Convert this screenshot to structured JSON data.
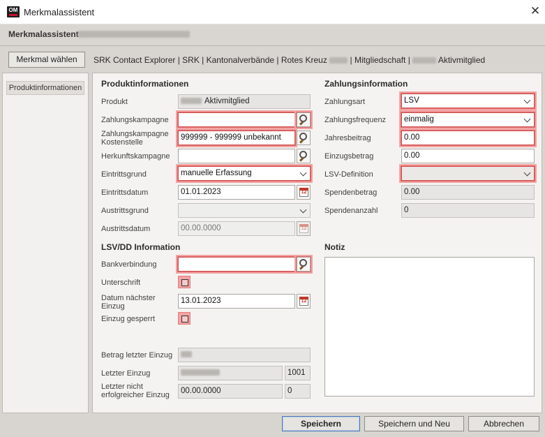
{
  "window": {
    "title": "Merkmalassistent",
    "logo": "OM",
    "close_icon": "close-icon"
  },
  "header": {
    "title": "Merkmalassistent"
  },
  "toolbar": {
    "merkmal_button": "Merkmal wählen",
    "breadcrumb_1": "SRK Contact Explorer | SRK | Kantonalverbände | Rotes Kreuz",
    "breadcrumb_2": "| Mitgliedschaft |",
    "breadcrumb_3": "Aktivmitglied"
  },
  "nav": {
    "items": [
      {
        "label": "Produktinformationen"
      }
    ]
  },
  "produkt": {
    "section_title": "Produktinformationen",
    "produkt_label": "Produkt",
    "produkt_value": "Aktivmitglied",
    "zahlungskampagne_label": "Zahlungskampagne",
    "zahlungskampagne_value": "",
    "kostenstelle_label_1": "Zahlungskampagne",
    "kostenstelle_label_2": "Kostenstelle",
    "kostenstelle_value": "999999 - 999999 unbekannt",
    "herkunft_label": "Herkunftskampagne",
    "herkunft_value": "",
    "eintrittsgrund_label": "Eintrittsgrund",
    "eintrittsgrund_value": "manuelle Erfassung",
    "eintrittsdatum_label": "Eintrittsdatum",
    "eintrittsdatum_value": "01.01.2023",
    "austrittsgrund_label": "Austrittsgrund",
    "austrittsgrund_value": "",
    "austrittsdatum_label": "Austrittsdatum",
    "austrittsdatum_value": "00.00.0000"
  },
  "lsv": {
    "section_title": "LSV/DD Information",
    "bank_label": "Bankverbindung",
    "bank_value": "",
    "unterschrift_label": "Unterschrift",
    "datum_label_1": "Datum nächster",
    "datum_label_2": "Einzug",
    "datum_value": "13.01.2023",
    "gesperrt_label": "Einzug gesperrt",
    "betrag_label": "Betrag letzter Einzug",
    "letzter_label": "Letzter Einzug",
    "letzter_count": "1001",
    "nicht_label_1": "Letzter nicht",
    "nicht_label_2": "erfolgreicher Einzug",
    "nicht_value": "00.00.0000",
    "nicht_count": "0"
  },
  "zahlung": {
    "section_title": "Zahlungsinformation",
    "art_label": "Zahlungsart",
    "art_value": "LSV",
    "frequenz_label": "Zahlungsfrequenz",
    "frequenz_value": "einmalig",
    "jahresbeitrag_label": "Jahresbeitrag",
    "jahresbeitrag_value": "0.00",
    "einzugsbetrag_label": "Einzugsbetrag",
    "einzugsbetrag_value": "0.00",
    "lsvdef_label": "LSV-Definition",
    "lsvdef_value": "",
    "spendenbetrag_label": "Spendenbetrag",
    "spendenbetrag_value": "0.00",
    "spendenanzahl_label": "Spendenanzahl",
    "spendenanzahl_value": "0"
  },
  "notiz": {
    "section_title": "Notiz",
    "value": ""
  },
  "buttons": {
    "save": "Speichern",
    "save_new": "Speichern und Neu",
    "cancel": "Abbrechen"
  },
  "colors": {
    "required_highlight": "#f2a5a5",
    "default_button_border": "#4d78b8"
  }
}
